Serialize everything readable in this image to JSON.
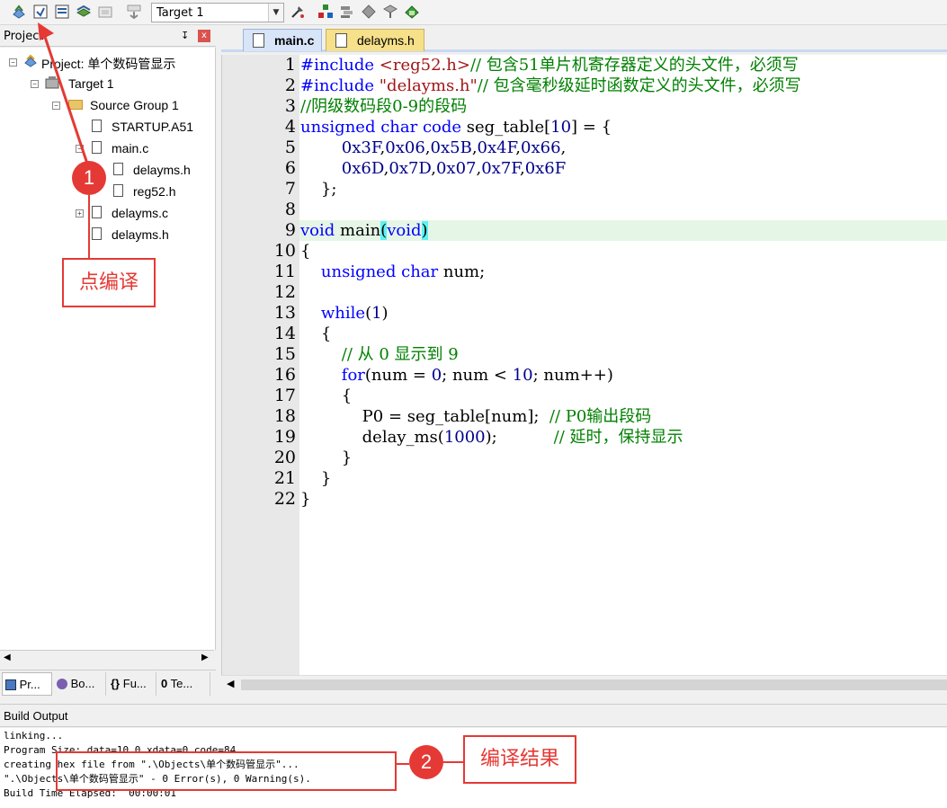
{
  "toolbar": {
    "target_value": "Target 1",
    "icons": [
      "translate-icon",
      "build-icon",
      "rebuild-icon",
      "batch-build-icon",
      "stop-build-icon",
      "load-icon",
      "target-options-icon",
      "manage-components-icon",
      "pack-installer-icon",
      "select-device-icon",
      "manage-runtime-icon"
    ]
  },
  "project_panel": {
    "title": "Project",
    "pin_glyph": "↧",
    "close_glyph": "x",
    "tree": {
      "root": "Project: 单个数码管显示",
      "target": "Target 1",
      "group": "Source Group 1",
      "startup": "STARTUP.A51",
      "main_c": "main.c",
      "delayms_h_child": "delayms.h",
      "reg52_h": "reg52.h",
      "delayms_c": "delayms.c",
      "delayms_h": "delayms.h"
    },
    "tabs": [
      "Pr...",
      "Bo...",
      "Fu...",
      "Te..."
    ]
  },
  "editor": {
    "tabs": [
      {
        "label": "main.c",
        "active": true
      },
      {
        "label": "delayms.h",
        "active": false
      }
    ],
    "highlighted_line": 9
  },
  "build": {
    "title": "Build Output",
    "lines": [
      "linking...",
      "Program Size: data=10.0 xdata=0 code=84",
      "creating hex file from \".\\Objects\\单个数码管显示\"...",
      "\".\\Objects\\单个数码管显示\" - 0 Error(s), 0 Warning(s).",
      "Build Time Elapsed:  00:00:01"
    ]
  },
  "annotations": {
    "step1_number": "1",
    "step1_label": "点编译",
    "step2_number": "2",
    "step2_label": "编译结果"
  },
  "colors": {
    "annotation_red": "#e53935",
    "keyword_blue": "#0000ff",
    "comment_green": "#008000",
    "include_string": "#a31515",
    "current_line_bg": "#e6f6e6",
    "brace_match": "#5cf3f3"
  }
}
